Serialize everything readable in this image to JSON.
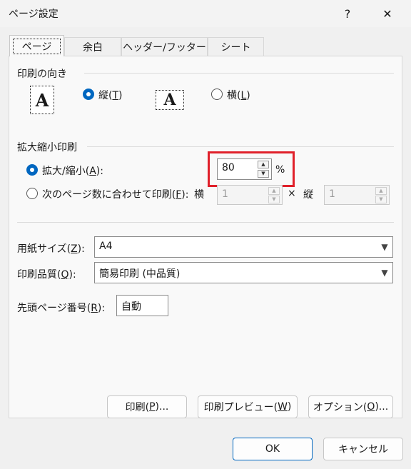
{
  "window": {
    "title": "ページ設定",
    "help_label": "?",
    "close_label": "✕"
  },
  "tabs": [
    {
      "label": "ページ"
    },
    {
      "label": "余白"
    },
    {
      "label": "ヘッダー/フッター"
    },
    {
      "label": "シート"
    }
  ],
  "orientation": {
    "label": "印刷の向き",
    "portrait": {
      "text": "縦(",
      "key": "T",
      "end": ")",
      "selected": true
    },
    "landscape": {
      "text": "横(",
      "key": "L",
      "end": ")",
      "selected": false
    },
    "icon_letter": "A"
  },
  "scaling": {
    "label": "拡大縮小印刷",
    "adjust": {
      "text": "拡大/縮小(",
      "key": "A",
      "end": "):",
      "selected": true
    },
    "percent_value": "80",
    "percent_unit": "%",
    "fit": {
      "text": "次のページ数に合わせて印刷(",
      "key": "F",
      "end": "):",
      "selected": false
    },
    "wide_label": "横",
    "wide_value": "1",
    "times_label": "×",
    "tall_label": "縦",
    "tall_value": "1"
  },
  "paper": {
    "size_label": {
      "text": "用紙サイズ(",
      "key": "Z",
      "end": "):"
    },
    "size_value": "A4",
    "quality_label": {
      "text": "印刷品質(",
      "key": "Q",
      "end": "):"
    },
    "quality_value": "簡易印刷 (中品質)",
    "first_page_label": {
      "text": "先頭ページ番号(",
      "key": "R",
      "end": "):"
    },
    "first_page_value": "自動"
  },
  "buttons": {
    "print": {
      "text": "印刷(",
      "key": "P",
      "end": ")..."
    },
    "preview": {
      "text": "印刷プレビュー(",
      "key": "W",
      "end": ")"
    },
    "options": {
      "text": "オプション(",
      "key": "O",
      "end": ")..."
    },
    "ok": "OK",
    "cancel": "キャンセル"
  },
  "colors": {
    "accent": "#0067c0",
    "highlight_box": "#e0202a"
  }
}
